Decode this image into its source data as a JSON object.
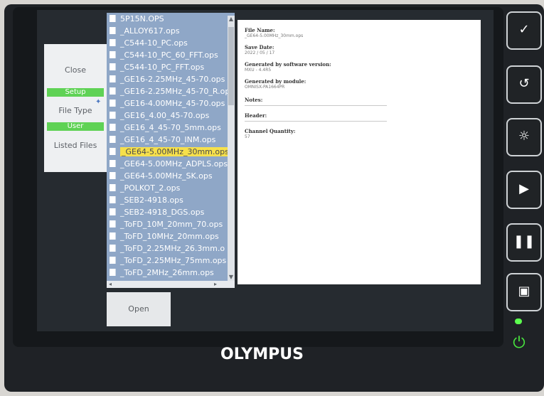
{
  "device": {
    "brand": "OLYMPUS"
  },
  "left_panel": {
    "close_label": "Close",
    "setup_label": "Setup",
    "file_type_label": "File Type",
    "user_label": "User",
    "listed_files_label": "Listed Files"
  },
  "file_list": {
    "items": [
      "5P15N.OPS",
      "_ALLOY617.ops",
      "_C544-10_PC.ops",
      "_C544-10_PC_60_FFT.ops",
      "_C544-10_PC_FFT.ops",
      "_GE16-2.25MHz_45-70.ops",
      "_GE16-2.25MHz_45-70_R.op",
      "_GE16-4.00MHz_45-70.ops",
      "_GE16_4.00_45-70.ops",
      "_GE16_4_45-70_5mm.ops",
      "_GE16_4_45-70_INM.ops",
      "_GE64-5.00MHz_30mm.ops",
      "_GE64-5.00MHz_ADPLS.ops",
      "_GE64-5.00MHz_SK.ops",
      "_POLKOT_2.ops",
      "_SEB2-4918.ops",
      "_SEB2-4918_DGS.ops",
      "_ToFD_10M_20mm_70.ops",
      "_ToFD_10MHz_20mm.ops",
      "_ToFD_2.25MHz_26.3mm.o",
      "_ToFD_2.25MHz_75mm.ops",
      "_ToFD_2MHz_26mm.ops"
    ],
    "selected_index": 11
  },
  "open_button": {
    "label": "Open"
  },
  "details": {
    "file_name_title": "File Name:",
    "file_name_value": "_GE64-5.00MHz_30mm.ops",
    "save_date_title": "Save Date:",
    "save_date_value": "2022 / 05 / 17",
    "sw_version_title": "Generated by software version:",
    "sw_version_value": "MXU - 4.4R5",
    "module_title": "Generated by module:",
    "module_value": "OMNISX-PA1664PR",
    "notes_title": "Notes:",
    "header_title": "Header:",
    "channel_qty_title": "Channel Quantity:",
    "channel_qty_value": "57"
  },
  "side_keys": [
    "check-icon",
    "undo-icon",
    "brightness-icon",
    "play-icon",
    "pause-icon",
    "save-icon",
    "power-icon"
  ],
  "colors": {
    "selection": "#f6e04b",
    "green_tab": "#5fd255",
    "list_bg": "#8fa7c7",
    "power_led": "#5cff4f"
  }
}
